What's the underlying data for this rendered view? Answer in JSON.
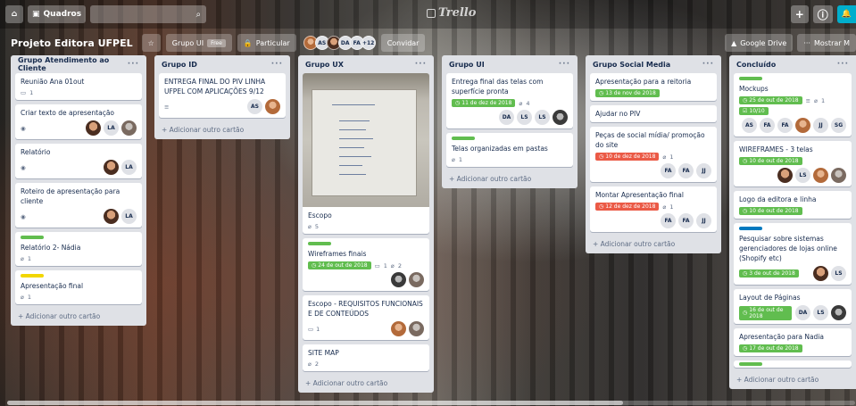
{
  "header": {
    "home_label": "⌂",
    "boards_label": "Quadros",
    "search_icon": "⌕",
    "logo_text": "Trello",
    "add_label": "+",
    "info_label": "ⓘ",
    "bell_label": "🔔"
  },
  "board": {
    "title": "Projeto Editora UFPEL",
    "star": "☆",
    "team_label": "Grupo UI",
    "team_badge": "Free",
    "visibility_label": "Particular",
    "members": [
      "AS",
      "DA",
      "FA"
    ],
    "extra_members": "+12",
    "invite_label": "Convidar",
    "google_drive_label": "Google Drive",
    "show_menu_label": "Mostrar M"
  },
  "lists": [
    {
      "name": "Grupo Atendimento ao Cliente",
      "add_label": "+ Adicionar outro cartão",
      "cards": [
        {
          "title": "Reunião Ana 01out",
          "comments": "1"
        },
        {
          "title": "Criar texto de apresentação",
          "members": [
            "LA"
          ]
        },
        {
          "title": "Relatório",
          "members": [
            "LA"
          ]
        },
        {
          "title": "Roteiro de apresentação para cliente",
          "members": [
            "LA"
          ]
        },
        {
          "title": "Relatório 2- Nádia",
          "attachments": "1"
        },
        {
          "title": "Apresentação final",
          "attachments": "1"
        }
      ]
    },
    {
      "name": "Grupo ID",
      "add_label": "+ Adicionar outro cartão",
      "cards": [
        {
          "title": "ENTREGA FINAL DO PIV LINHA UFPEL COM APLICAÇÕES 9/12",
          "members": [
            "AS"
          ]
        }
      ]
    },
    {
      "name": "Grupo UX",
      "add_label": "+ Adicionar outro cartão",
      "cards": [
        {
          "title": "Escopo",
          "attachments": "5"
        },
        {
          "title": "Wireframes finais",
          "due": "24 de out de 2018",
          "comments": "1",
          "attachments": "2"
        },
        {
          "title": "Escopo - REQUISITOS FUNCIONAIS E DE CONTEÚDOS",
          "comments": "1"
        },
        {
          "title": "SITE MAP",
          "attachments": "2"
        }
      ]
    },
    {
      "name": "Grupo UI",
      "add_label": "+ Adicionar outro cartão",
      "cards": [
        {
          "title": "Entrega final das telas com superfície pronta",
          "due": "11 de dez de 2018",
          "attachments": "4",
          "members": [
            "DA",
            "LS",
            "LS"
          ]
        },
        {
          "title": "Telas organizadas em pastas",
          "attachments": "1"
        }
      ]
    },
    {
      "name": "Grupo Social Media",
      "add_label": "+ Adicionar outro cartão",
      "cards": [
        {
          "title": "Apresentação para a reitoria",
          "due": "13 de nov de 2018"
        },
        {
          "title": "Ajudar no PIV"
        },
        {
          "title": "Peças de social mídia/ promoção do site",
          "due": "10 de dez de 2018",
          "attachments": "1",
          "members": [
            "FA",
            "FA",
            "JJ"
          ]
        },
        {
          "title": "Montar Apresentação final",
          "due": "12 de dez de 2018",
          "attachments": "1",
          "members": [
            "FA",
            "FA",
            "JJ"
          ]
        }
      ]
    },
    {
      "name": "Concluído",
      "add_label": "+ Adicionar outro cartão",
      "cards": [
        {
          "title": "Mockups",
          "due": "25 de out de 2018",
          "attachments": "1",
          "checklist": "10/10",
          "members": [
            "AS",
            "FA",
            "FA",
            "JJ",
            "SG"
          ]
        },
        {
          "title": "WIREFRAMES - 3 telas",
          "due": "10 de out de 2018",
          "members": [
            "LS"
          ]
        },
        {
          "title": "Logo da editora e linha",
          "due": "10 de out de 2018"
        },
        {
          "title": "Pesquisar sobre sistemas gerenciadores de lojas online (Shopify etc)",
          "due": "3 de out de 2018",
          "members": [
            "LS"
          ]
        },
        {
          "title": "Layout de Páginas",
          "due": "16 de out de 2018",
          "members": [
            "DA",
            "LS"
          ]
        },
        {
          "title": "Apresentação para Nadia",
          "due": "17 de out de 2018"
        }
      ]
    }
  ],
  "colors": {
    "green_label": "#61bd4f",
    "yellow_label": "#f2d600",
    "blue_label": "#0079bf",
    "red_due": "#eb5a46"
  }
}
